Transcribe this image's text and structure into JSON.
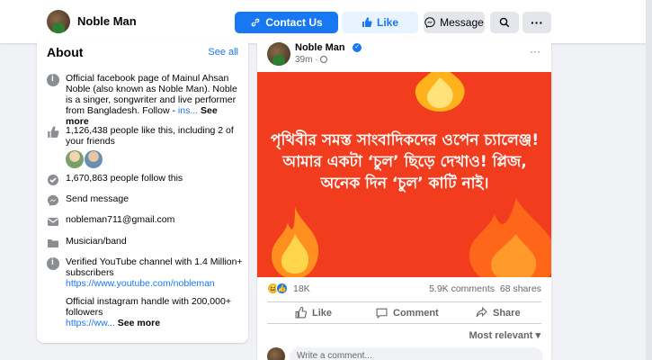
{
  "header": {
    "page_name": "Noble Man",
    "contact_label": "Contact Us",
    "like_label": "Like",
    "message_label": "Message",
    "more_label": "···"
  },
  "about": {
    "title": "About",
    "see_all": "See all",
    "description": "Official facebook page of Mainul Ahsan Noble (also known as Noble Man). Noble is a singer, songwriter and live performer from Bangladesh. Follow - ",
    "description_link": "ins...",
    "see_more": "See more",
    "likes": "1,126,438 people like this, including 2 of your friends",
    "follows": "1,670,863 people follow this",
    "send_message": "Send message",
    "email": "nobleman711@gmail.com",
    "category": "Musician/band",
    "youtube_text": "Verified YouTube channel with 1.4 Million+ subscribers",
    "youtube_link": "https://www.youtube.com/nobleman",
    "instagram_text": "Official instagram handle with 200,000+ followers",
    "instagram_link": "https://ww...",
    "instagram_see_more": "See more"
  },
  "post": {
    "author": "Noble Man",
    "time": "39m · ",
    "more": "···",
    "image_text": "পৃথিবীর সমস্ত সাংবাদিকদের ওপেন চ্যালেঞ্জ! আমার একটা ‘চুল’ ছিড়ে দেখাও! প্লিজ, অনেক দিন ‘চুল’ কাটি নাই।",
    "reaction_count": "18K",
    "comments": "5.9K comments",
    "shares": "68 shares",
    "like_action": "Like",
    "comment_action": "Comment",
    "share_action": "Share",
    "sort_label": "Most relevant",
    "comment_placeholder": "Write a comment..."
  },
  "colors": {
    "accent": "#1877f2",
    "post_bg": "#f23c1e",
    "page_bg": "#f0f2f5"
  }
}
